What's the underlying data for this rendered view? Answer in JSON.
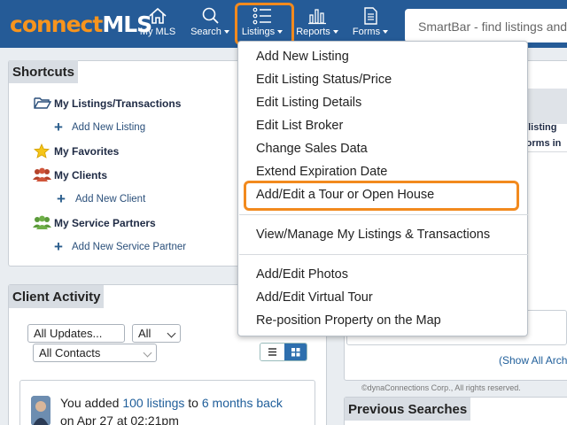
{
  "brand": {
    "part1": "connect",
    "part2": "MLS",
    "orange": "#f7941d",
    "topbar_color": "#255b97"
  },
  "nav": [
    {
      "label": "My MLS",
      "icon": "home-icon",
      "caret": false
    },
    {
      "label": "Search",
      "icon": "search-icon",
      "caret": true
    },
    {
      "label": "Listings",
      "icon": "list-icon",
      "caret": true,
      "highlighted": true
    },
    {
      "label": "Reports",
      "icon": "bar-chart-icon",
      "caret": true
    },
    {
      "label": "Forms",
      "icon": "document-icon",
      "caret": true
    }
  ],
  "smartbar": {
    "placeholder": "SmartBar - find listings and"
  },
  "shortcuts": {
    "title": "Shortcuts",
    "items": [
      {
        "label": "My Listings/Transactions",
        "icon": "folder-icon",
        "sub": "Add New Listing"
      },
      {
        "label": "My Favorites",
        "icon": "star-icon",
        "sub": ""
      },
      {
        "label": "My Clients",
        "icon": "people-icon",
        "sub": "Add New Client"
      },
      {
        "label": "My Service Partners",
        "icon": "partners-icon",
        "sub": "Add New Service Partner"
      }
    ]
  },
  "client_activity": {
    "title": "Client Activity",
    "filter_updates": "All Updates...",
    "filter_all": "All",
    "filter_contacts": "All Contacts",
    "activity": {
      "prefix": "You added ",
      "count_link": "100 listings",
      "middle": " to ",
      "target_link": "6 months back",
      "time": "on Apr 27 at 02:21pm"
    }
  },
  "right": {
    "text1": "l listing",
    "text2": "forms in",
    "show_all": "(Show All Arch",
    "copyright": "©dynaConnections Corp., All rights reserved.",
    "previous_searches": "Previous Searches"
  },
  "listings_menu": {
    "group1": [
      "Add New Listing",
      "Edit Listing Status/Price",
      "Edit Listing Details",
      "Edit List Broker",
      "Change Sales Data",
      "Extend Expiration Date",
      "Add/Edit a Tour or Open House"
    ],
    "group2": [
      "View/Manage My Listings & Transactions"
    ],
    "group3": [
      "Add/Edit Photos",
      "Add/Edit Virtual Tour",
      "Re-position Property on the Map"
    ],
    "highlight_color": "#f28a1e"
  }
}
